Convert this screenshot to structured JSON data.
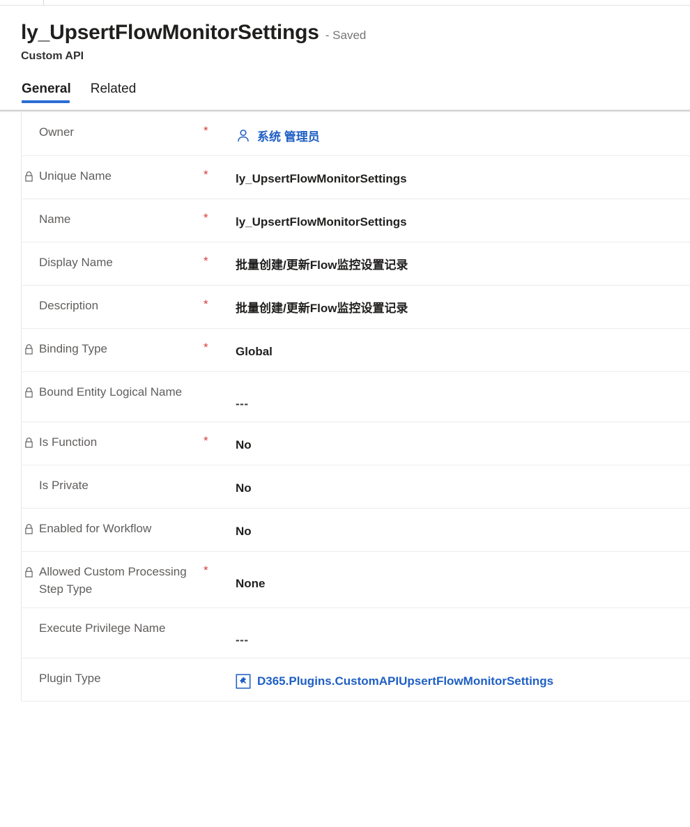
{
  "header": {
    "record_title": "ly_UpsertFlowMonitorSettings",
    "saved_state": "- Saved",
    "entity_type": "Custom API"
  },
  "tabs": [
    {
      "label": "General",
      "selected": true
    },
    {
      "label": "Related",
      "selected": false
    }
  ],
  "colors": {
    "accent": "#2b6cd4",
    "link": "#1f5fc4",
    "required": "#d93b3b",
    "label": "#605e5c",
    "value": "#201f1e"
  },
  "form": {
    "rows": [
      {
        "label": "Owner",
        "locked": false,
        "required": true,
        "value": "系统 管理员",
        "value_kind": "link-person",
        "icon": "person-icon",
        "two_line": false
      },
      {
        "label": "Unique Name",
        "locked": true,
        "required": true,
        "value": "ly_UpsertFlowMonitorSettings",
        "value_kind": "text",
        "two_line": false
      },
      {
        "label": "Name",
        "locked": false,
        "required": true,
        "value": "ly_UpsertFlowMonitorSettings",
        "value_kind": "text",
        "two_line": false
      },
      {
        "label": "Display Name",
        "locked": false,
        "required": true,
        "value": "批量创建/更新Flow监控设置记录",
        "value_kind": "text",
        "two_line": false
      },
      {
        "label": "Description",
        "locked": false,
        "required": true,
        "value": "批量创建/更新Flow监控设置记录",
        "value_kind": "text",
        "two_line": false
      },
      {
        "label": "Binding Type",
        "locked": true,
        "required": true,
        "value": "Global",
        "value_kind": "text",
        "two_line": false
      },
      {
        "label": "Bound Entity Logical Name",
        "locked": true,
        "required": false,
        "value": "---",
        "value_kind": "empty",
        "two_line": true
      },
      {
        "label": "Is Function",
        "locked": true,
        "required": true,
        "value": "No",
        "value_kind": "text",
        "two_line": false
      },
      {
        "label": "Is Private",
        "locked": false,
        "required": false,
        "value": "No",
        "value_kind": "text",
        "two_line": false
      },
      {
        "label": "Enabled for Workflow",
        "locked": true,
        "required": false,
        "value": "No",
        "value_kind": "text",
        "two_line": false
      },
      {
        "label": "Allowed Custom Processing Step Type",
        "locked": true,
        "required": true,
        "value": "None",
        "value_kind": "text",
        "two_line": true
      },
      {
        "label": "Execute Privilege Name",
        "locked": false,
        "required": false,
        "value": "---",
        "value_kind": "empty",
        "two_line": true
      },
      {
        "label": "Plugin Type",
        "locked": false,
        "required": false,
        "value": "D365.Plugins.CustomAPIUpsertFlowMonitorSettings",
        "value_kind": "link-plugin",
        "icon": "plugin-icon",
        "two_line": false
      }
    ]
  }
}
